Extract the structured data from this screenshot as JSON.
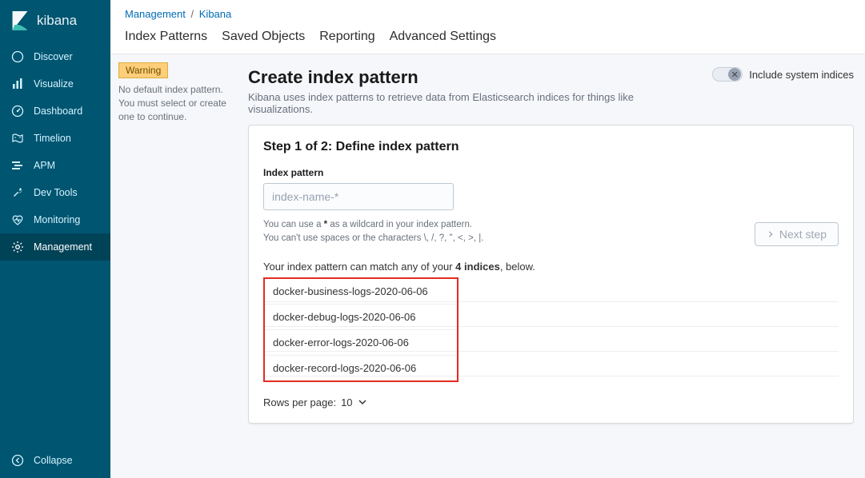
{
  "logo": {
    "text": "kibana"
  },
  "nav": {
    "items": [
      {
        "label": "Discover"
      },
      {
        "label": "Visualize"
      },
      {
        "label": "Dashboard"
      },
      {
        "label": "Timelion"
      },
      {
        "label": "APM"
      },
      {
        "label": "Dev Tools"
      },
      {
        "label": "Monitoring"
      },
      {
        "label": "Management"
      }
    ],
    "collapse": "Collapse"
  },
  "breadcrumb": {
    "a": "Management",
    "b": "Kibana"
  },
  "tabs": [
    {
      "label": "Index Patterns"
    },
    {
      "label": "Saved Objects"
    },
    {
      "label": "Reporting"
    },
    {
      "label": "Advanced Settings"
    }
  ],
  "warning": {
    "badge": "Warning",
    "msg": "No default index pattern. You must select or create one to continue."
  },
  "page": {
    "title": "Create index pattern",
    "desc": "Kibana uses index patterns to retrieve data from Elasticsearch indices for things like visualizations.",
    "include_label": "Include system indices"
  },
  "step": {
    "title": "Step 1 of 2: Define index pattern",
    "field_label": "Index pattern",
    "placeholder": "index-name-*",
    "hint1_pre": "You can use a ",
    "hint1_bold": "*",
    "hint1_post": " as a wildcard in your index pattern.",
    "hint2": "You can't use spaces or the characters \\, /, ?, \", <, >, |.",
    "next": "Next step",
    "match_pre": "Your index pattern can match any of your ",
    "match_bold": "4 indices",
    "match_post": ", below.",
    "indices": [
      "docker-business-logs-2020-06-06",
      "docker-debug-logs-2020-06-06",
      "docker-error-logs-2020-06-06",
      "docker-record-logs-2020-06-06"
    ],
    "rows_per_label": "Rows per page:",
    "rows_per_value": "10"
  }
}
